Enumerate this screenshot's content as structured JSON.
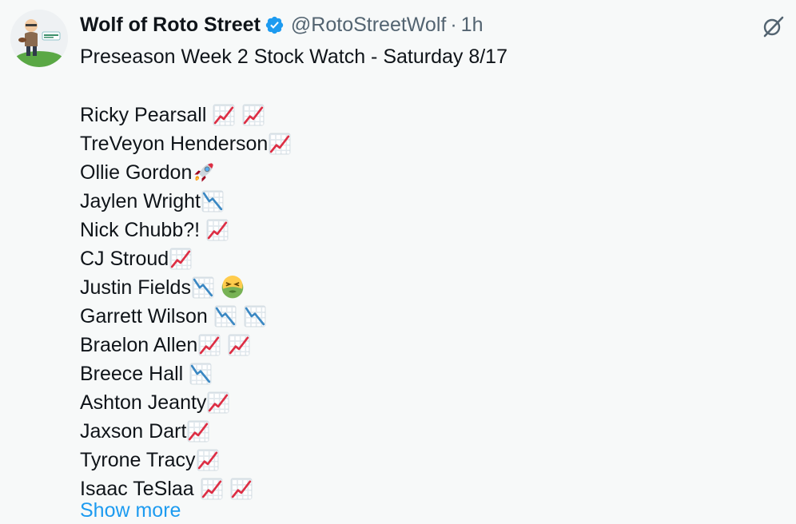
{
  "tweet": {
    "author_name": "Wolf of Roto Street",
    "handle": "@RotoStreetWolf",
    "separator": "·",
    "time": "1h",
    "text_title": "Preseason Week 2 Stock Watch - Saturday 8/17",
    "players": [
      {
        "name": "Ricky Pearsall",
        "gap": true,
        "icons": [
          "chart-increasing-icon",
          "chart-increasing-icon"
        ]
      },
      {
        "name": "TreVeyon Henderson",
        "gap": false,
        "icons": [
          "chart-increasing-icon"
        ]
      },
      {
        "name": "Ollie Gordon",
        "gap": false,
        "icons": [
          "rocket-icon"
        ]
      },
      {
        "name": "Jaylen Wright",
        "gap": false,
        "icons": [
          "chart-decreasing-icon"
        ]
      },
      {
        "name": "Nick Chubb?!",
        "gap": true,
        "icons": [
          "chart-increasing-icon"
        ]
      },
      {
        "name": "CJ Stroud",
        "gap": false,
        "icons": [
          "chart-increasing-icon"
        ]
      },
      {
        "name": "Justin Fields",
        "gap": false,
        "icons": [
          "chart-decreasing-icon",
          "nauseated-face-icon"
        ]
      },
      {
        "name": "Garrett Wilson",
        "gap": true,
        "icons": [
          "chart-decreasing-icon",
          "chart-decreasing-icon"
        ]
      },
      {
        "name": "Braelon Allen",
        "gap": false,
        "icons": [
          "chart-increasing-icon",
          "chart-increasing-icon"
        ]
      },
      {
        "name": "Breece Hall",
        "gap": true,
        "icons": [
          "chart-decreasing-icon"
        ]
      },
      {
        "name": "Ashton Jeanty",
        "gap": false,
        "icons": [
          "chart-increasing-icon"
        ]
      },
      {
        "name": "Jaxson Dart",
        "gap": false,
        "icons": [
          "chart-increasing-icon"
        ]
      },
      {
        "name": "Tyrone Tracy",
        "gap": false,
        "icons": [
          "chart-increasing-icon"
        ]
      },
      {
        "name": "Isaac TeSlaa",
        "gap": true,
        "icons": [
          "chart-increasing-icon",
          "chart-increasing-icon"
        ]
      }
    ],
    "show_more_label": "Show more"
  },
  "icons": {
    "verified": "verified-badge-icon",
    "grok": "grok-icon",
    "avatar": "avatar-image"
  },
  "colors": {
    "background": "#f7f9f9",
    "text": "#0f1419",
    "secondary_text": "#536471",
    "link": "#1d9bf0",
    "verified": "#1d9bf0",
    "chart_up": "#d7263d",
    "chart_down": "#2f7fd6"
  }
}
